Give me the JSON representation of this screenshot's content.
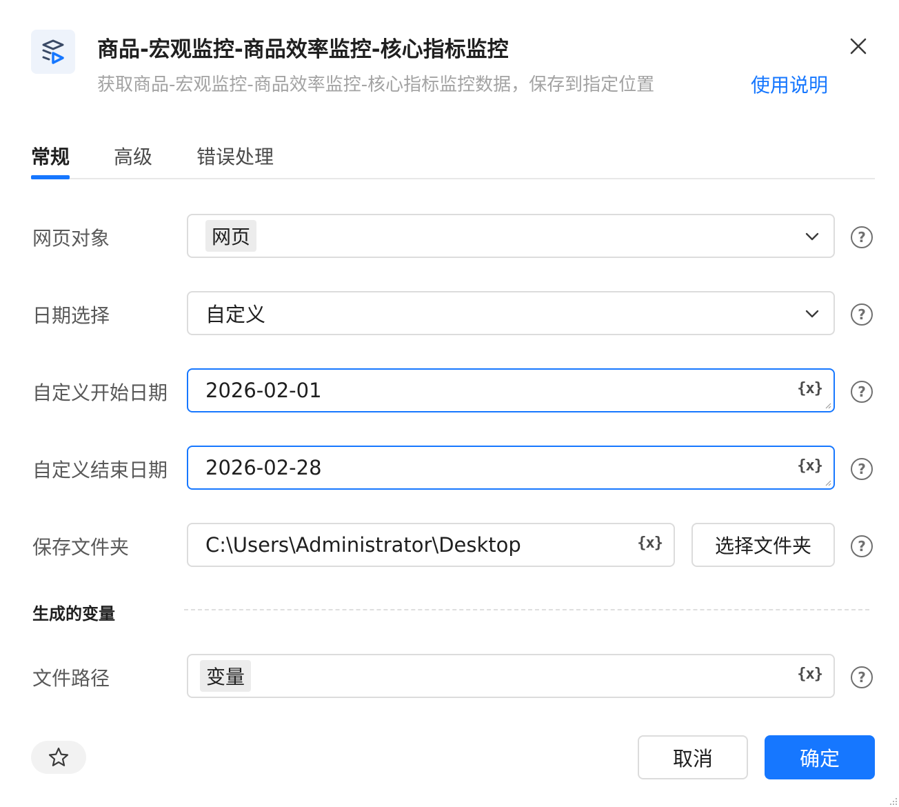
{
  "header": {
    "title": "商品-宏观监控-商品效率监控-核心指标监控",
    "subtitle": "获取商品-宏观监控-商品效率监控-核心指标监控数据，保存到指定位置",
    "help_link": "使用说明"
  },
  "tabs": [
    {
      "label": "常规",
      "active": true
    },
    {
      "label": "高级",
      "active": false
    },
    {
      "label": "错误处理",
      "active": false
    }
  ],
  "form": {
    "web_object": {
      "label": "网页对象",
      "value": "网页"
    },
    "date_select": {
      "label": "日期选择",
      "value": "自定义"
    },
    "start_date": {
      "label": "自定义开始日期",
      "value": "2026-02-01"
    },
    "end_date": {
      "label": "自定义结束日期",
      "value": "2026-02-28"
    },
    "save_folder": {
      "label": "保存文件夹",
      "value": "C:\\Users\\Administrator\\Desktop",
      "button": "选择文件夹"
    }
  },
  "variables_section": {
    "title": "生成的变量",
    "file_path": {
      "label": "文件路径",
      "value": "变量"
    }
  },
  "var_icon_text": "{x}",
  "help_glyph": "?",
  "footer": {
    "cancel": "取消",
    "ok": "确定"
  },
  "colors": {
    "accent": "#1677ff",
    "tag_bg": "#ececec",
    "border": "#dcdcdc"
  },
  "icons": [
    "flow-play-icon",
    "close-icon",
    "chevron-down-icon",
    "variable-icon",
    "help-icon",
    "star-icon"
  ]
}
